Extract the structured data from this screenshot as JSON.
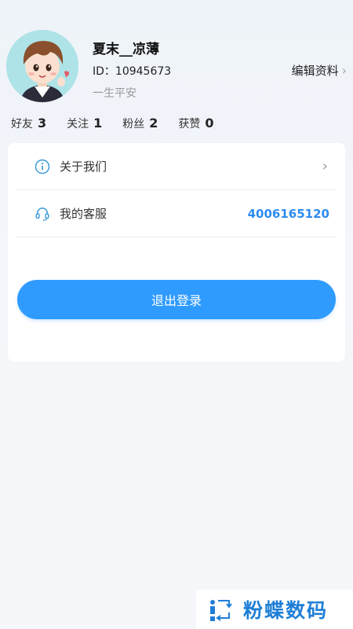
{
  "profile": {
    "username": "夏末__凉薄",
    "id_text": "ID：10945673",
    "motto": "一生平安",
    "edit_label": "编辑资料"
  },
  "stats": [
    {
      "label": "好友",
      "value": "3"
    },
    {
      "label": "关注",
      "value": "1"
    },
    {
      "label": "粉丝",
      "value": "2"
    },
    {
      "label": "获赞",
      "value": "0"
    }
  ],
  "menu": {
    "about_label": "关于我们",
    "service_label": "我的客服",
    "service_phone": "4006165120"
  },
  "logout_label": "退出登录",
  "watermark_text": "粉蝶数码",
  "colors": {
    "accent": "#2f9bff",
    "phone": "#2d8cf0",
    "icon": "#3a9ad9"
  }
}
